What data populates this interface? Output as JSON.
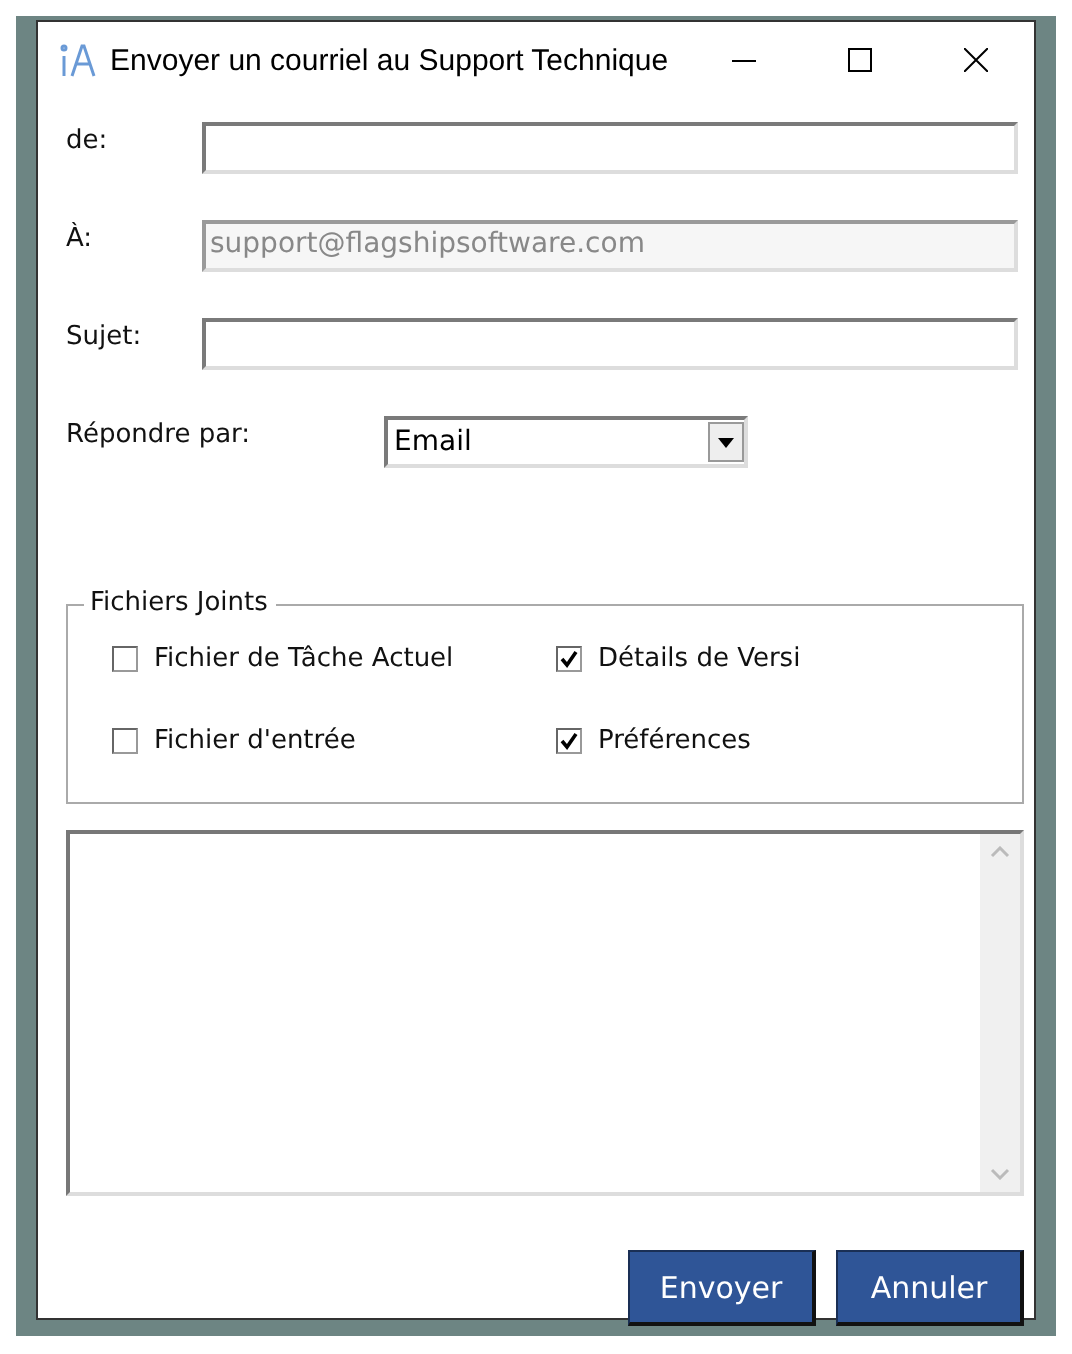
{
  "window": {
    "title": "Envoyer un courriel au Support Technique"
  },
  "fields": [
    {
      "label": "de:",
      "disabled": false
    },
    {
      "label": "À:",
      "value": "support@flagshipsoftware.com",
      "disabled": true
    },
    {
      "label": "Sujet:",
      "disabled": false
    }
  ],
  "reply_by": {
    "label": "Répondre par:",
    "value": "Email"
  },
  "attachments": {
    "title": "Fichiers Joints",
    "items": [
      {
        "label": "Fichier de Tâche Actuel",
        "checked": false
      },
      {
        "label": "Détails de Versi",
        "checked": true
      },
      {
        "label": "Fichier d'entrée",
        "checked": false
      },
      {
        "label": "Préférences",
        "checked": true
      }
    ]
  },
  "buttons": [
    "Envoyer",
    "Annuler"
  ]
}
